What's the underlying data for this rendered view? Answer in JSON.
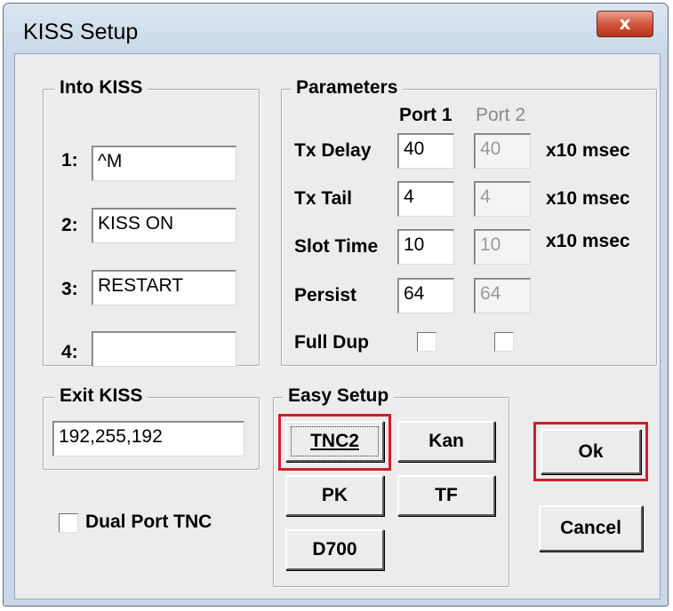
{
  "window": {
    "title": "KISS Setup",
    "close_label": "x"
  },
  "into_kiss": {
    "legend": "Into KISS",
    "rows": [
      {
        "label": "1:",
        "value": "^M"
      },
      {
        "label": "2:",
        "value": "KISS ON"
      },
      {
        "label": "3:",
        "value": "RESTART"
      },
      {
        "label": "4:",
        "value": ""
      }
    ]
  },
  "parameters": {
    "legend": "Parameters",
    "port1_header": "Port 1",
    "port2_header": "Port 2",
    "rows": [
      {
        "label": "Tx Delay",
        "port1": "40",
        "port2": "40",
        "unit": "x10 msec"
      },
      {
        "label": "Tx Tail",
        "port1": "4",
        "port2": "4",
        "unit": "x10 msec"
      },
      {
        "label": "Slot Time",
        "port1": "10",
        "port2": "10",
        "unit": "x10 msec"
      },
      {
        "label": "Persist",
        "port1": "64",
        "port2": "64",
        "unit": ""
      }
    ],
    "full_dup_label": "Full Dup",
    "full_dup_port1_checked": false,
    "full_dup_port2_checked": false
  },
  "exit_kiss": {
    "legend": "Exit KISS",
    "value": "192,255,192"
  },
  "dual_port": {
    "label": "Dual Port TNC",
    "checked": false
  },
  "easy_setup": {
    "legend": "Easy Setup",
    "buttons": [
      "TNC2",
      "Kan",
      "PK",
      "TF",
      "D700"
    ]
  },
  "actions": {
    "ok": "Ok",
    "cancel": "Cancel"
  },
  "highlight_color": "#cc1f2a"
}
